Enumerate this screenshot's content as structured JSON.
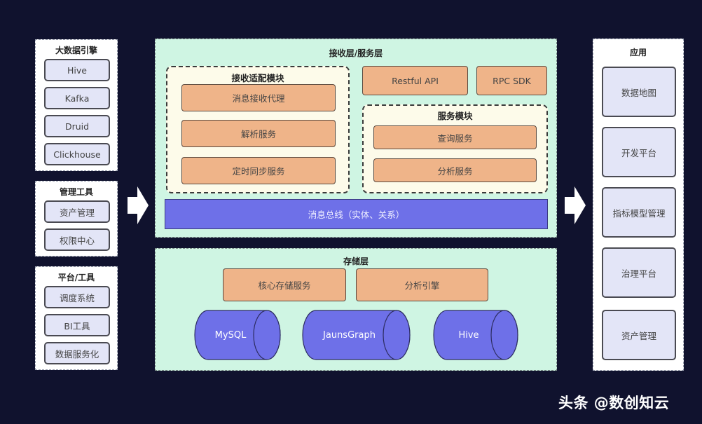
{
  "left_groups": [
    {
      "title": "大数据引擎",
      "items": [
        "Hive",
        "Kafka",
        "Druid",
        "Clickhouse"
      ]
    },
    {
      "title": "管理工具",
      "items": [
        "资产管理",
        "权限中心"
      ]
    },
    {
      "title": "平台/工具",
      "items": [
        "调度系统",
        "BI工具",
        "数据服务化"
      ]
    }
  ],
  "service_layer": {
    "title": "接收层/服务层",
    "receive_module": {
      "title": "接收适配模块",
      "items": [
        "消息接收代理",
        "解析服务",
        "定时同步服务"
      ]
    },
    "apis": [
      "Restful API",
      "RPC SDK"
    ],
    "service_module": {
      "title": "服务模块",
      "items": [
        "查询服务",
        "分析服务"
      ]
    },
    "bus": "消息总线（实体、关系）"
  },
  "storage_layer": {
    "title": "存储层",
    "services": [
      "核心存储服务",
      "分析引擎"
    ],
    "databases": [
      "MySQL",
      "JaunsGraph",
      "Hive"
    ]
  },
  "applications": {
    "title": "应用",
    "items": [
      "数据地图",
      "开发平台",
      "指标模型管理",
      "治理平台",
      "资产管理"
    ]
  },
  "icons": {
    "flow_arrow": "right-arrow",
    "db": "cylinder"
  },
  "colors": {
    "background": "#10122e",
    "layer_bg": "#cff5e3",
    "component": "#efb489",
    "bus": "#6e70e8",
    "tool_box": "#e3e5f7"
  },
  "watermark": "头条 @数创知云"
}
